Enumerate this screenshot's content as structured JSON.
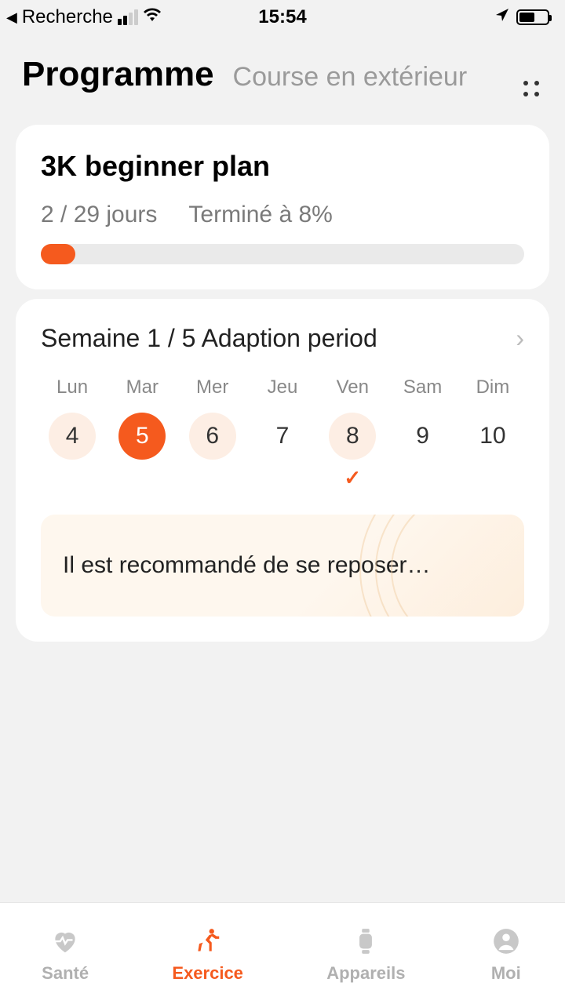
{
  "status": {
    "back_label": "Recherche",
    "time": "15:54"
  },
  "header": {
    "title": "Programme",
    "subtitle": "Course en extérieur"
  },
  "plan": {
    "title": "3K beginner plan",
    "days_text": "2 / 29 jours",
    "completion_text": "Terminé à 8%",
    "progress_percent": 8
  },
  "week": {
    "title": "Semaine 1 / 5 Adaption period",
    "days": [
      {
        "label": "Lun",
        "num": "4",
        "style": "light",
        "check": false
      },
      {
        "label": "Mar",
        "num": "5",
        "style": "selected",
        "check": false
      },
      {
        "label": "Mer",
        "num": "6",
        "style": "light",
        "check": false
      },
      {
        "label": "Jeu",
        "num": "7",
        "style": "none",
        "check": false
      },
      {
        "label": "Ven",
        "num": "8",
        "style": "light",
        "check": true
      },
      {
        "label": "Sam",
        "num": "9",
        "style": "none",
        "check": false
      },
      {
        "label": "Dim",
        "num": "10",
        "style": "none",
        "check": false
      }
    ],
    "tip": "Il est recommandé de se reposer…"
  },
  "nav": {
    "items": [
      {
        "label": "Santé",
        "icon": "heart-icon",
        "active": false
      },
      {
        "label": "Exercice",
        "icon": "runner-icon",
        "active": true
      },
      {
        "label": "Appareils",
        "icon": "watch-icon",
        "active": false
      },
      {
        "label": "Moi",
        "icon": "person-icon",
        "active": false
      }
    ]
  }
}
